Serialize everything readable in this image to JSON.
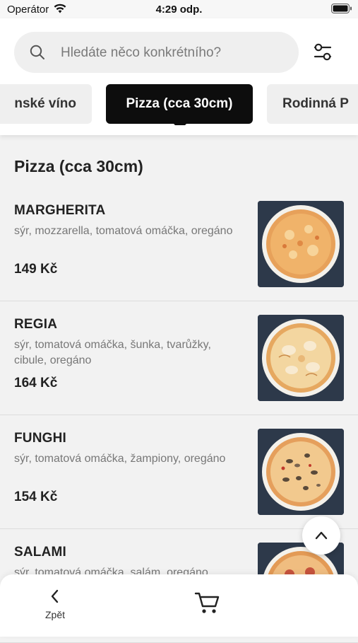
{
  "status_bar": {
    "carrier": "Operátor",
    "time": "4:29 odp."
  },
  "search": {
    "placeholder": "Hledáte něco konkrétního?"
  },
  "tabs": {
    "previous": "nské víno",
    "active": "Pizza (cca 30cm)",
    "next": "Rodinná P"
  },
  "section": {
    "title": "Pizza (cca 30cm)"
  },
  "items": [
    {
      "name": "MARGHERITA",
      "description": "sýr, mozzarella, tomatová omáčka, oregáno",
      "price": "149 Kč"
    },
    {
      "name": "REGIA",
      "description": "sýr, tomatová omáčka, šunka, tvarůžky, cibule, oregáno",
      "price": "164 Kč"
    },
    {
      "name": "FUNGHI",
      "description": "sýr, tomatová omáčka, žampiony, oregáno",
      "price": "154 Kč"
    },
    {
      "name": "SALAMI",
      "description": "sýr, tomatová omáčka, salám, oregáno",
      "price": ""
    }
  ],
  "bottom_nav": {
    "back_label": "Zpět"
  },
  "colors": {
    "active_tab": "#0d0d0d",
    "background": "#f2f2f2",
    "accent_text": "#222222"
  },
  "icons": [
    "wifi-icon",
    "battery-icon",
    "search-icon",
    "filter-icon",
    "chevron-up-icon",
    "chevron-left-icon",
    "cart-icon"
  ]
}
